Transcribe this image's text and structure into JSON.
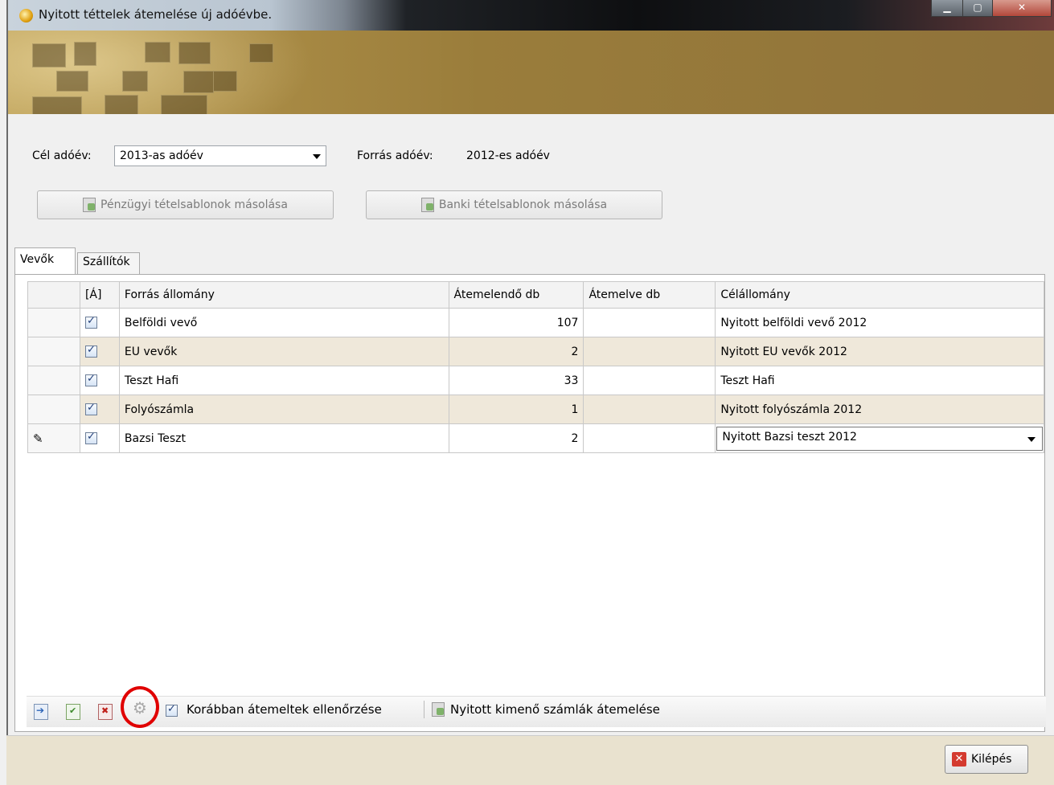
{
  "window": {
    "title": "Nyitott téttelek átemelése új adóévbe."
  },
  "form": {
    "target_year_label": "Cél adóév:",
    "target_year_value": "2013-as adóév",
    "source_year_label": "Forrás adóév:",
    "source_year_value": "2012-es adóév",
    "btn_financial": "Pénzügyi tételsablonok másolása",
    "btn_bank": "Banki tételsablonok másolása"
  },
  "tabs": [
    "Vevők",
    "Szállítók"
  ],
  "grid": {
    "columns": [
      "[Á]",
      "Forrás állomány",
      "Átemelendő db",
      "Átemelve db",
      "Célállomány"
    ],
    "rows": [
      {
        "source": "Belföldi vevő",
        "to_transfer": "107",
        "transferred": "",
        "target": "Nyitott belföldi vevő 2012"
      },
      {
        "source": "EU vevők",
        "to_transfer": "2",
        "transferred": "",
        "target": "Nyitott EU vevők 2012"
      },
      {
        "source": "Teszt Hafi",
        "to_transfer": "33",
        "transferred": "",
        "target": "Teszt Hafi"
      },
      {
        "source": "Folyószámla",
        "to_transfer": "1",
        "transferred": "",
        "target": "Nyitott folyószámla 2012"
      },
      {
        "source": "Bazsi Teszt",
        "to_transfer": "2",
        "transferred": "",
        "target": "Nyitott Bazsi teszt 2012"
      }
    ]
  },
  "toolbar": {
    "check_label": "Korábban átemeltek ellenőrzése",
    "transfer_label": "Nyitott kimenő számlák átemelése"
  },
  "footer": {
    "exit_label": "Kilépés"
  },
  "colors": {
    "alt_row": "#efe8da",
    "highlight": "#e00000"
  }
}
